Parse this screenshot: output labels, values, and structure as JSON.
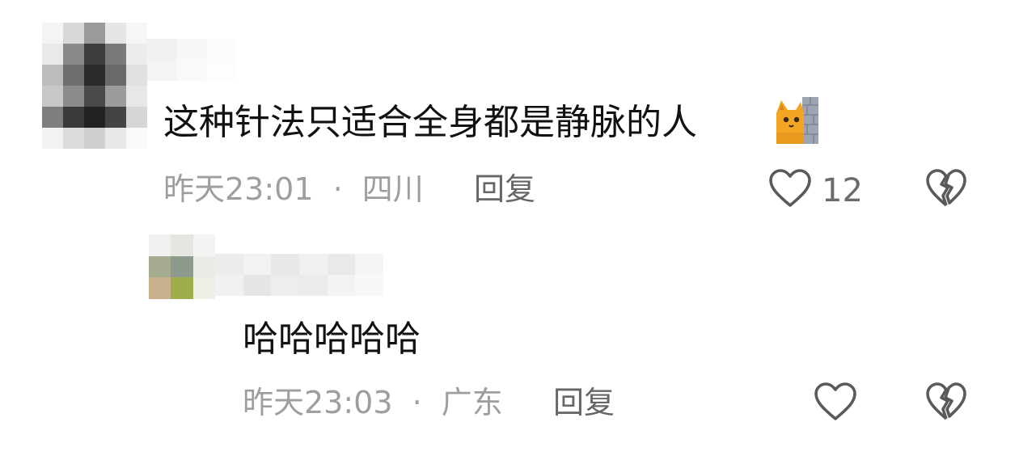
{
  "comments": [
    {
      "text": "这种针法只适合全身都是静脉的人",
      "emoji": "cat-peeking-icon",
      "time": "昨天23:01",
      "separator": "·",
      "location": "四川",
      "reply_label": "回复",
      "likes": "12"
    },
    {
      "text": "哈哈哈哈哈",
      "time": "昨天23:03",
      "separator": "·",
      "location": "广东",
      "reply_label": "回复",
      "likes": ""
    }
  ],
  "colors": {
    "text": "#111111",
    "meta": "#9e9e9e",
    "reply": "#666666",
    "icon": "#5a5a5a"
  }
}
